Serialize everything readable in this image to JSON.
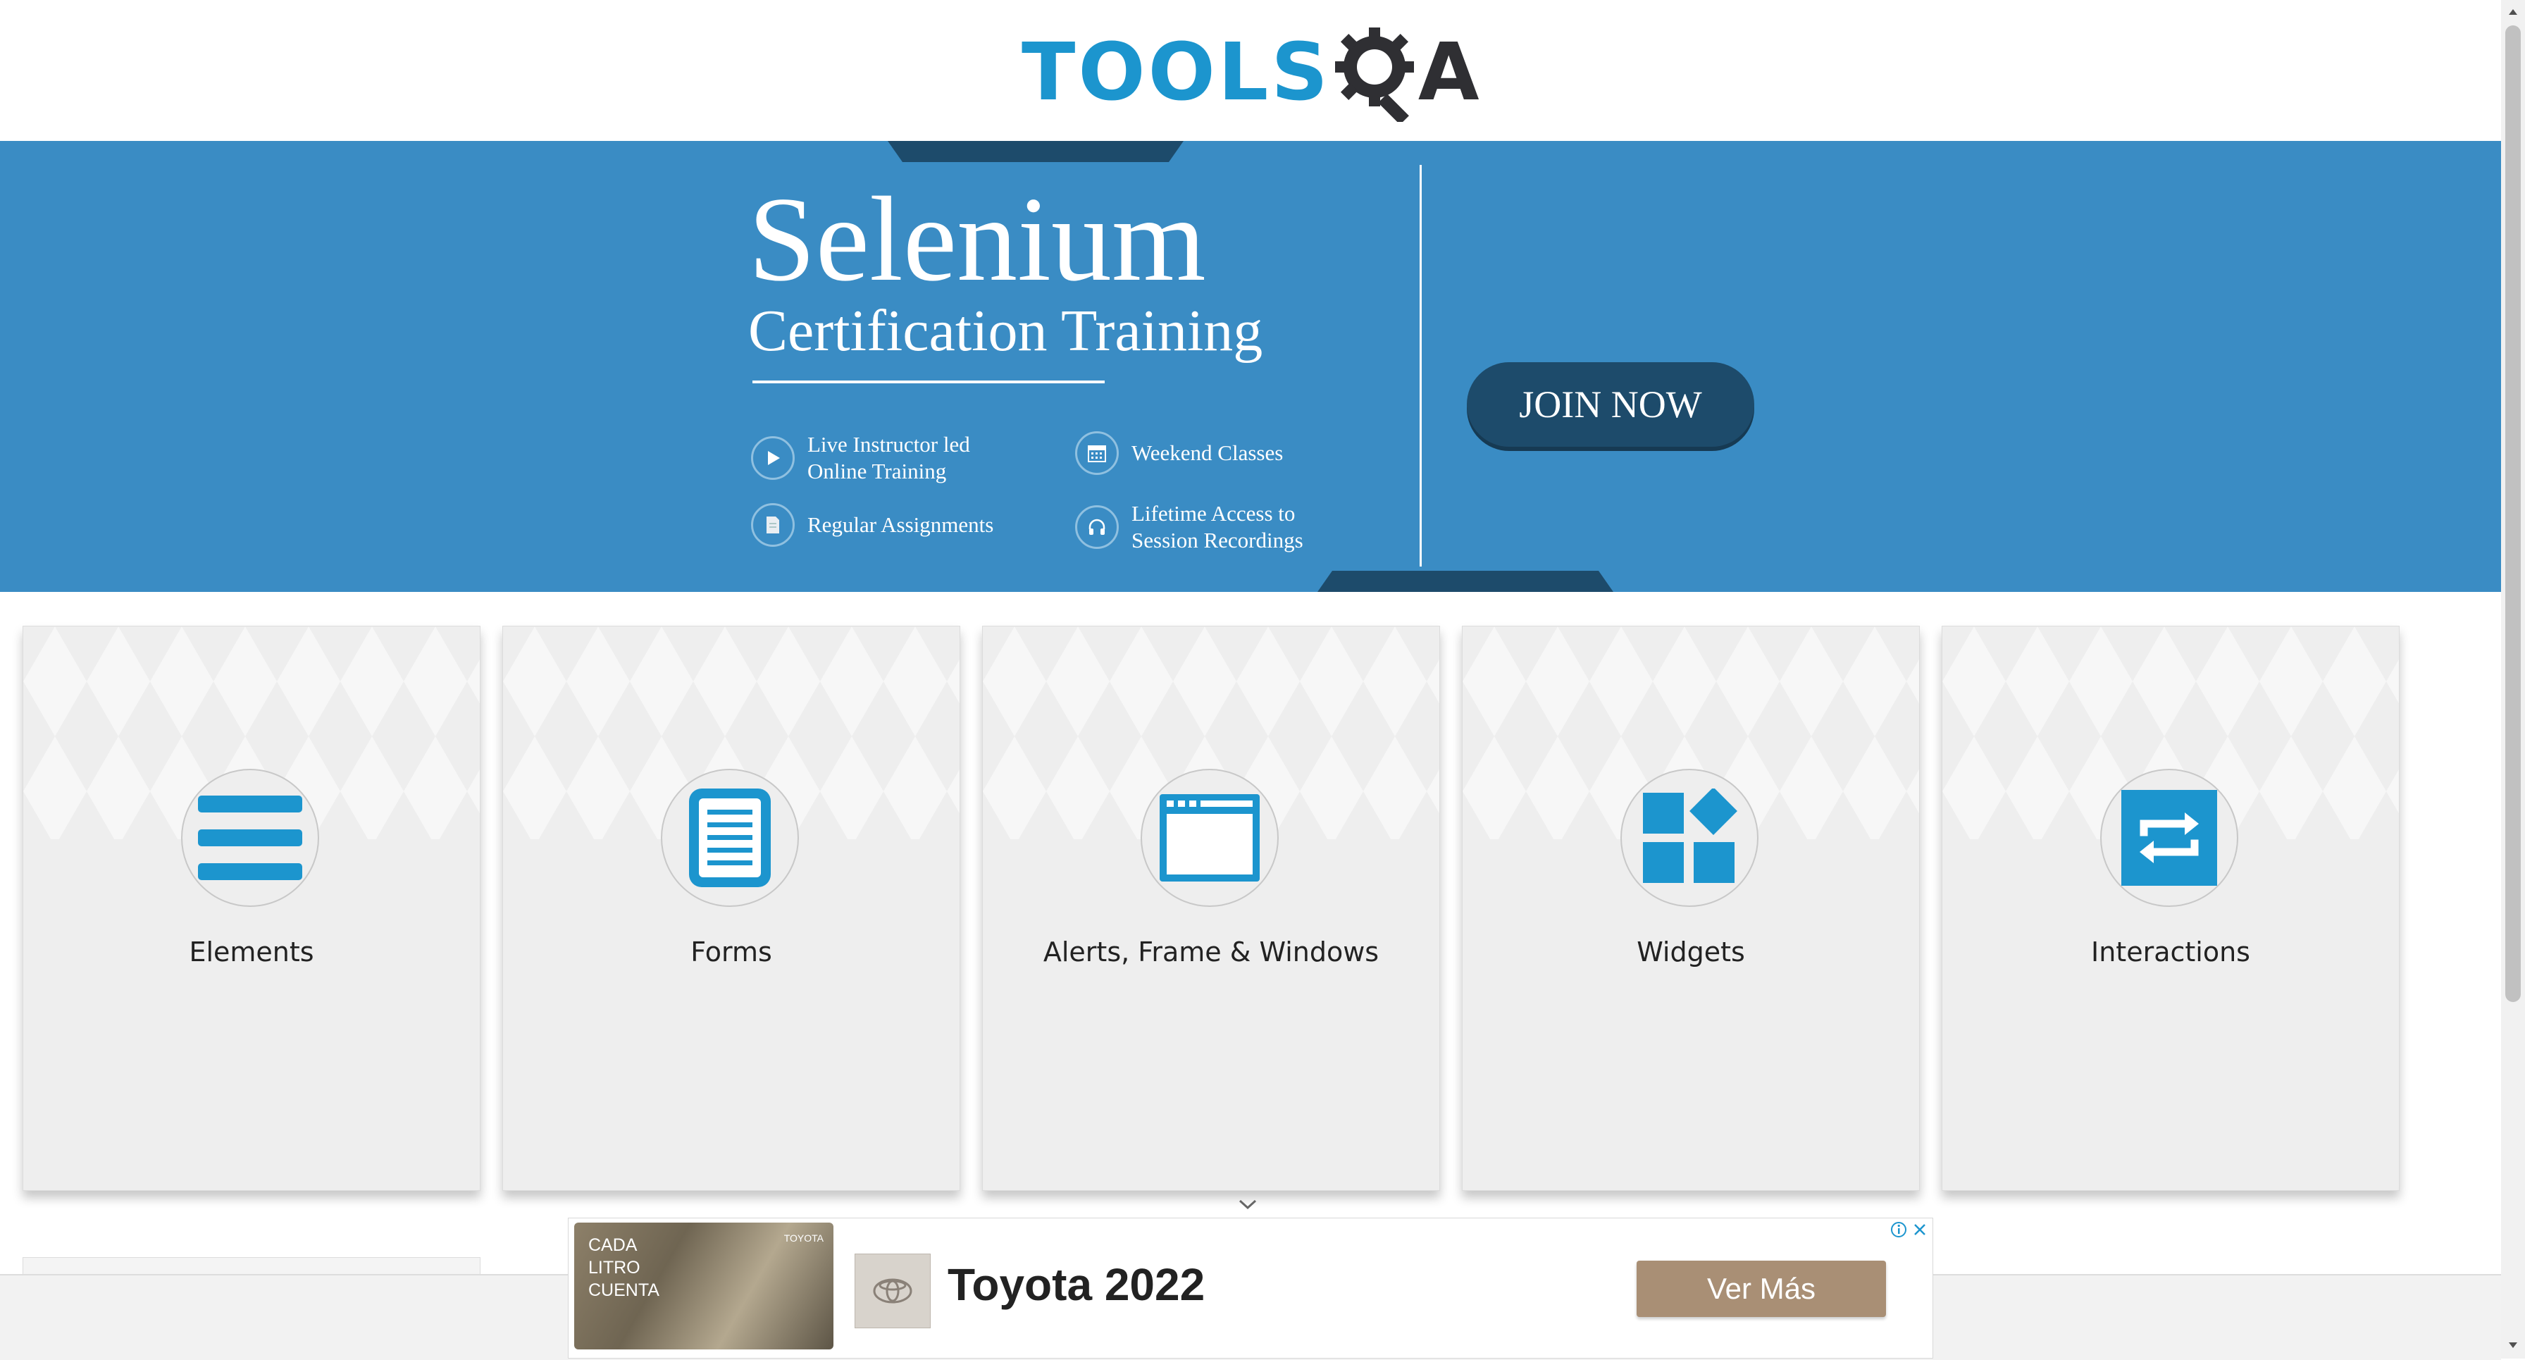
{
  "header": {
    "logo": {
      "part1": "TOOLS",
      "part2": "A"
    }
  },
  "banner": {
    "title": "Selenium",
    "subtitle": "Certification Training",
    "features": [
      {
        "icon": "play-icon",
        "text": "Live Instructor led Online Training"
      },
      {
        "icon": "calendar-icon",
        "text": "Weekend Classes"
      },
      {
        "icon": "document-icon",
        "text": "Regular Assignments"
      },
      {
        "icon": "headphones-icon",
        "text": "Lifetime Access to Session Recordings"
      }
    ],
    "cta_label": "JOIN NOW",
    "colors": {
      "background": "#3a8cc4",
      "dark": "#1d4b6b"
    }
  },
  "cards": [
    {
      "label": "Elements",
      "icon": "hamburger-menu-icon"
    },
    {
      "label": "Forms",
      "icon": "document-lines-icon"
    },
    {
      "label": "Alerts, Frame & Windows",
      "icon": "browser-window-icon"
    },
    {
      "label": "Widgets",
      "icon": "widgets-blocks-icon"
    },
    {
      "label": "Interactions",
      "icon": "swap-arrows-icon"
    }
  ],
  "accent_color": "#1c95ce",
  "ad": {
    "thumb_text": "CADA LITRO CUENTA",
    "thumb_brand": "TOYOTA",
    "title": "Toyota 2022",
    "cta": "Ver Más",
    "info_icon": "info-icon",
    "close_icon": "close-icon"
  }
}
